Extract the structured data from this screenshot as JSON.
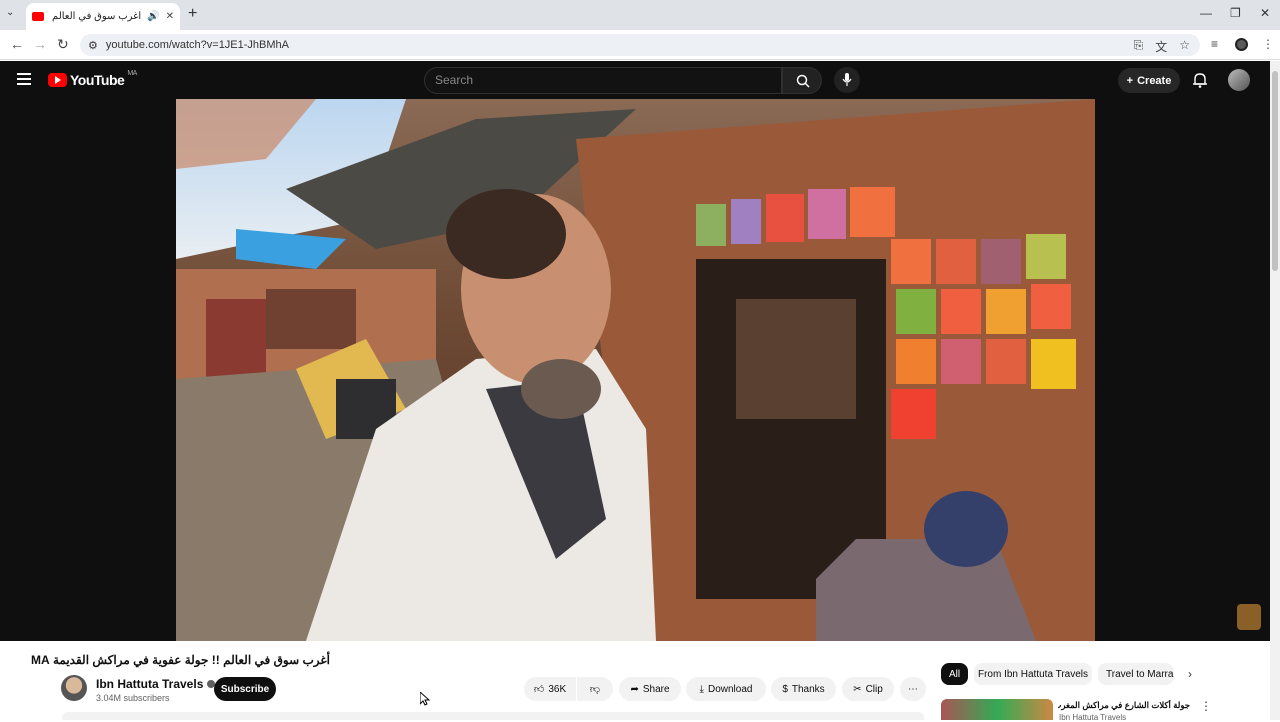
{
  "browser": {
    "tab_title": "أغرب سوق في العالم !! جولة",
    "tab_audio_icon": "speaker-icon",
    "url": "youtube.com/watch?v=1JE1-JhBMhA"
  },
  "masthead": {
    "logo_text": "YouTube",
    "country_code": "MA",
    "search_placeholder": "Search",
    "create_label": "Create"
  },
  "video": {
    "title": "أغرب سوق في العالم !! جولة عفوية في مراكش القديمة MA",
    "channel_name": "Ibn Hattuta Travels",
    "subscribers": "3.04M subscribers",
    "subscribe_label": "Subscribe",
    "like_count": "36K",
    "share_label": "Share",
    "download_label": "Download",
    "thanks_label": "Thanks",
    "clip_label": "Clip"
  },
  "sidebar": {
    "chips": [
      "All",
      "From Ibn Hattuta Travels",
      "Travel to Marrak"
    ],
    "next_item_title": "جولة أكلات الشارع في مراكش المغرب MA",
    "next_item_channel": "Ibn Hattuta Travels"
  },
  "colors": {
    "brand_red": "#ff0000",
    "dark_bg": "#0f0f0f"
  }
}
